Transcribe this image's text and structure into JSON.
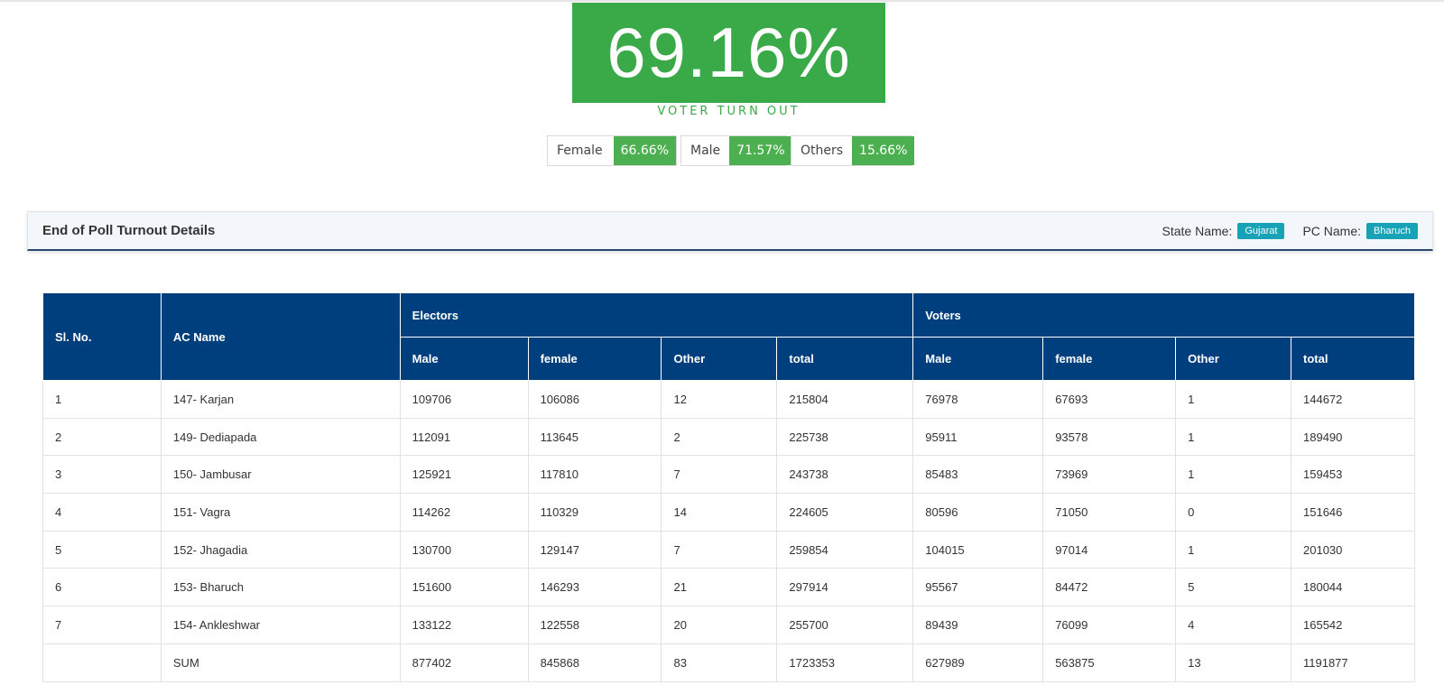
{
  "turnout": {
    "value": "69.16%",
    "label": "VOTER TURN OUT"
  },
  "gender": {
    "female": {
      "label": "Female",
      "value": "66.66%"
    },
    "male": {
      "label": "Male",
      "value": "71.57%"
    },
    "others": {
      "label": "Others",
      "value": "15.66%"
    }
  },
  "details": {
    "title": "End of Poll Turnout Details",
    "state_label": "State Name:",
    "state_value": "Gujarat",
    "pc_label": "PC Name:",
    "pc_value": "Bharuch"
  },
  "table": {
    "headers": {
      "sl_no": "Sl. No.",
      "ac_name": "AC Name",
      "electors": "Electors",
      "voters": "Voters",
      "male": "Male",
      "female": "female",
      "other": "Other",
      "total": "total"
    },
    "rows": [
      [
        "1",
        "147- Karjan",
        "109706",
        "106086",
        "12",
        "215804",
        "76978",
        "67693",
        "1",
        "144672"
      ],
      [
        "2",
        "149- Dediapada",
        "112091",
        "113645",
        "2",
        "225738",
        "95911",
        "93578",
        "1",
        "189490"
      ],
      [
        "3",
        "150- Jambusar",
        "125921",
        "117810",
        "7",
        "243738",
        "85483",
        "73969",
        "1",
        "159453"
      ],
      [
        "4",
        "151- Vagra",
        "114262",
        "110329",
        "14",
        "224605",
        "80596",
        "71050",
        "0",
        "151646"
      ],
      [
        "5",
        "152- Jhagadia",
        "130700",
        "129147",
        "7",
        "259854",
        "104015",
        "97014",
        "1",
        "201030"
      ],
      [
        "6",
        "153- Bharuch",
        "151600",
        "146293",
        "21",
        "297914",
        "95567",
        "84472",
        "5",
        "180044"
      ],
      [
        "7",
        "154- Ankleshwar",
        "133122",
        "122558",
        "20",
        "255700",
        "89439",
        "76099",
        "4",
        "165542"
      ],
      [
        "",
        "SUM",
        "877402",
        "845868",
        "83",
        "1723353",
        "627989",
        "563875",
        "13",
        "1191877"
      ]
    ]
  }
}
